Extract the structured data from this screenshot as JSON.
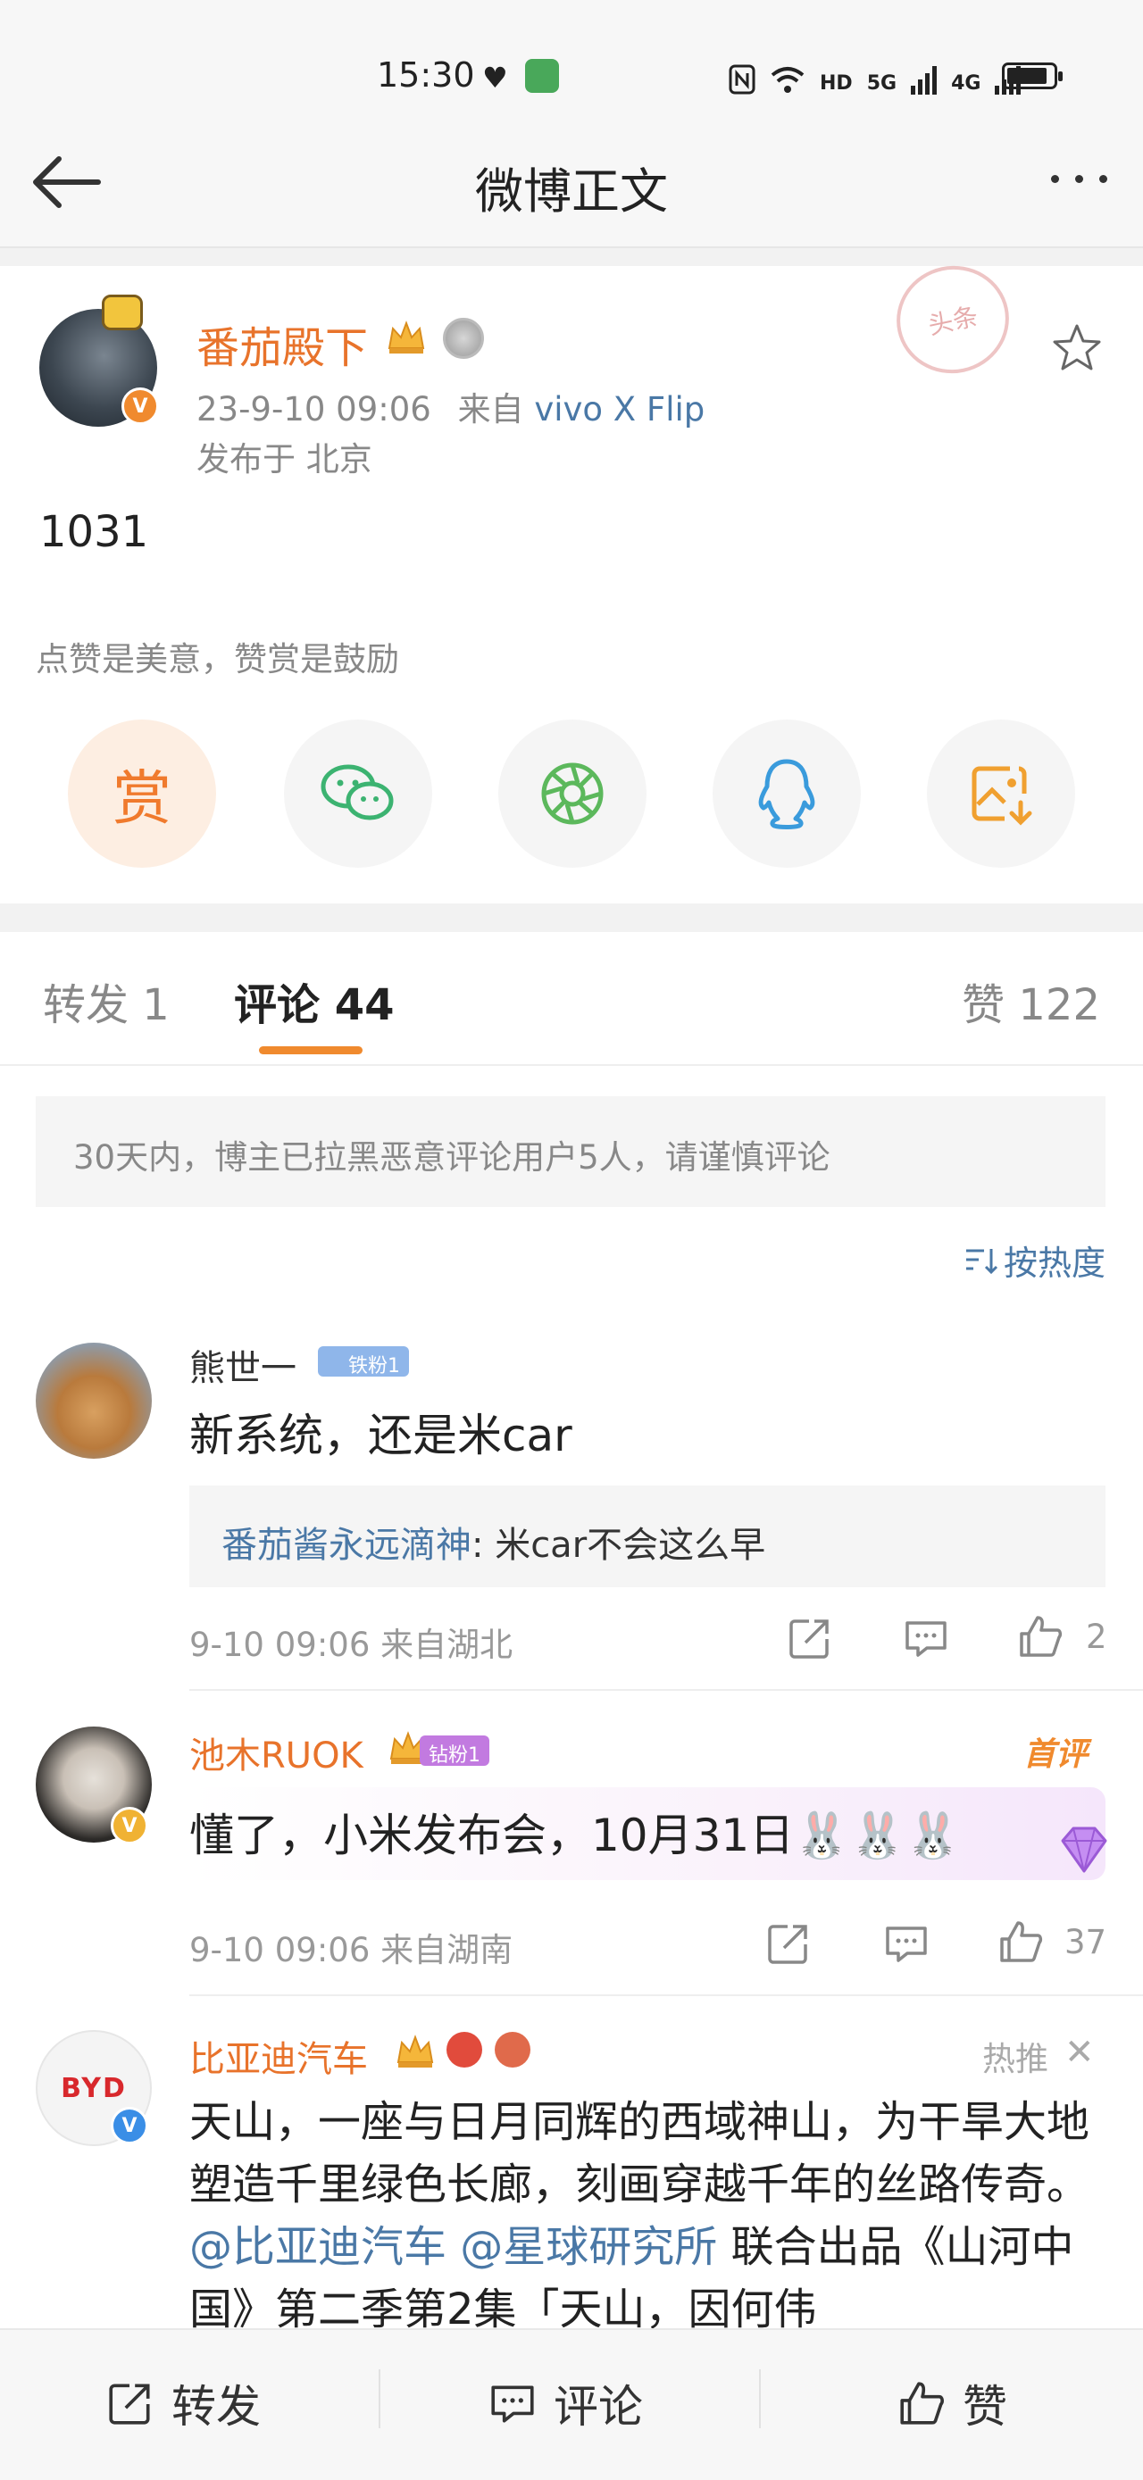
{
  "status_bar": {
    "time": "15:30",
    "network_labels": [
      "HD",
      "5G",
      "4G"
    ],
    "icons": [
      "heart-icon",
      "location-app-icon",
      "nfc-icon",
      "wifi-icon",
      "signal-icon",
      "battery-icon"
    ]
  },
  "nav": {
    "title": "微博正文",
    "back_icon": "arrow-left-icon",
    "more_icon": "more-horizontal-icon"
  },
  "post": {
    "author": "番茄殿下",
    "meta_time": "23-9-10 09:06",
    "meta_from": "来自",
    "meta_device": "vivo X Flip",
    "location": "发布于 北京",
    "stamp_text": "头条",
    "text": "1031",
    "reward_tip": "点赞是美意，赞赏是鼓励",
    "reward_label": "赏",
    "share_icons": [
      "reward-icon",
      "wechat-icon",
      "moments-icon",
      "qq-icon",
      "save-image-icon"
    ],
    "colors": {
      "accent": "#e8732b",
      "link": "#4a78a6"
    }
  },
  "tabs": {
    "repost": "转发 1",
    "comment": "评论 44",
    "like": "赞 122"
  },
  "notice": "30天内，博主已拉黑恶意评论用户5人，请谨慎评论",
  "sort_label": "按热度",
  "comments": [
    {
      "name": "熊世一",
      "badge": "铁粉1",
      "text": "新系统，还是米car",
      "reply_name": "番茄酱永远滴神",
      "reply_text": ": 米car不会这么早",
      "meta": "9-10 09:06  来自湖北",
      "likes": "2"
    },
    {
      "name": "池木RUOK",
      "badge": "钻粉1",
      "tag": "首评",
      "text": "懂了，小米发布会，10月31日🐰🐰🐰",
      "meta": "9-10 09:06  来自湖南",
      "likes": "37"
    },
    {
      "name": "比亚迪汽车",
      "avatar_text": "BYD",
      "hot_tag": "热推",
      "close": "✕",
      "text_1": "天山，一座与日月同辉的西域神山，为干旱大地塑造千里绿色长廊，刻画穿越千年的丝路传奇。",
      "mention_1": "@比亚迪汽车",
      "mention_2": "@星球研究所",
      "text_2": " 联合出品《山河中国》第二季第2集「天山，因何伟"
    }
  ],
  "bottom_bar": {
    "repost": "转发",
    "comment": "评论",
    "like": "赞"
  }
}
